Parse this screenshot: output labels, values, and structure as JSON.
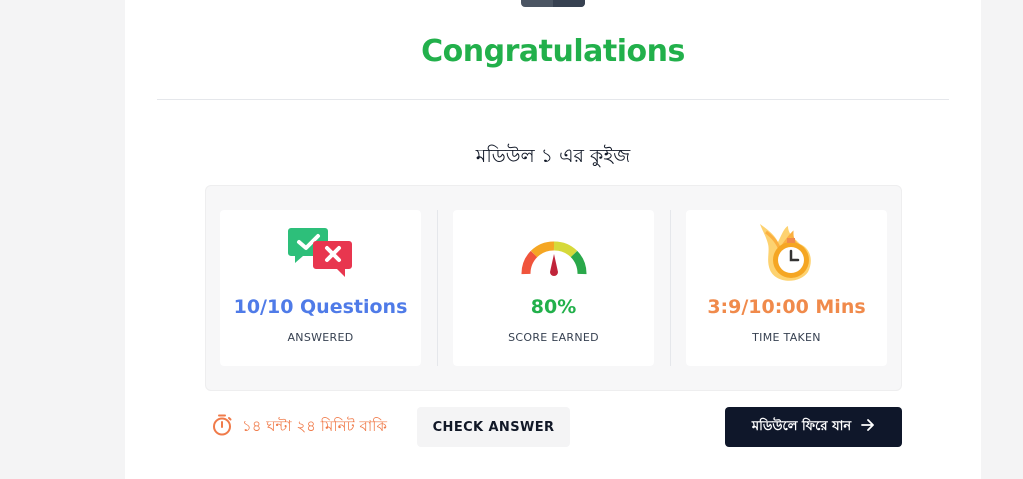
{
  "header": {
    "title": "Congratulations",
    "quiz_name": "মডিউল ১ এর কুইজ"
  },
  "stats": [
    {
      "icon": "check-cross-chat-icon",
      "value": "10/10 Questions",
      "label": "ANSWERED",
      "color": "#4f7be8"
    },
    {
      "icon": "gauge-meter-icon",
      "value": "80%",
      "label": "SCORE EARNED",
      "color": "#22b04b"
    },
    {
      "icon": "flaming-clock-icon",
      "value": "3:9/10:00 Mins",
      "label": "TIME TAKEN",
      "color": "#f08a4b"
    }
  ],
  "footer": {
    "timer_icon": "stopwatch-icon",
    "time_left": "১৪ ঘন্টা ২৪ মিনিট বাকি",
    "check_answer_label": "CHECK ANSWER",
    "back_label": "মডিউলে ফিরে যান",
    "back_icon": "arrow-right-icon"
  },
  "colors": {
    "accent_green": "#22b04b",
    "accent_blue": "#4f7be8",
    "accent_orange": "#f07b4a",
    "dark_button": "#0f172a"
  }
}
